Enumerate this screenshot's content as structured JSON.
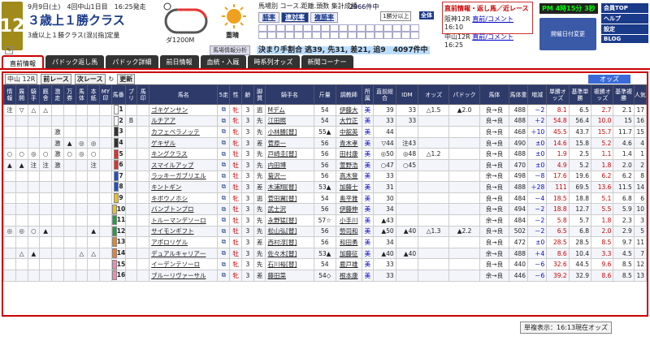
{
  "race": {
    "num": "12",
    "date": "9月9日(土)　4回中山1日目　16:25発走",
    "title": "３歳上１勝クラス",
    "cond": "3歳以上１勝クラス(混)[指]定量",
    "dist": "ダ1200M",
    "weather": "重晴"
  },
  "mid": {
    "title": "馬場別 コース.距離.頭数 集計成績",
    "tabs": [
      "勝率",
      "連対率",
      "複勝率"
    ],
    "count": "2966件中",
    "popular": "1勝分以上",
    "all": "全体",
    "analysis": "馬場情報分析",
    "kimari": "決まり手割合 逃39, 先31, 差21, 追9　4097件中"
  },
  "alerts": {
    "title": "直前情報・返し馬／近レース",
    "rows": [
      {
        "race": "阪神12R",
        "links": "直前/コメント",
        "time": "16:10"
      },
      {
        "race": "中山12R",
        "links": "直前/コメント",
        "time": "16:25"
      }
    ]
  },
  "clock": "PM 4時15分 3秒",
  "hold": "開催日付変更",
  "side": [
    "会員TOP",
    "ヘルプ",
    "設定",
    "BLOG"
  ],
  "tabs": [
    "直前情報",
    "パドック返し馬",
    "パドック詳細",
    "前日情報",
    "血統・入厩",
    "時系列オッズ",
    "新聞コーナー"
  ],
  "toolbar": {
    "race": "中山 12R",
    "prev": "前レース",
    "next": "次レース",
    "update": "更新",
    "odds": "オッズ"
  },
  "headers": [
    "情報",
    "展開",
    "騎手",
    "厩舎",
    "激走",
    "万券",
    "馬体",
    "本紙",
    "MY印",
    "馬番",
    "ブリ",
    "馬印",
    "馬名",
    "5走",
    "性",
    "齢",
    "脚質",
    "騎手名",
    "斤量",
    "調教師",
    "所属",
    "直前総合",
    "IDM",
    "オッズ",
    "パドック",
    "馬体",
    "馬体重",
    "増減",
    "単勝オッズ",
    "基準単勝",
    "複勝オッズ",
    "基準複勝",
    "人気"
  ],
  "rows": [
    {
      "mk": [
        "注",
        "▽",
        "△",
        "△",
        "",
        "",
        "",
        "",
        "",
        ""
      ],
      "n": "1",
      "bl": "",
      "horse": "ゴキゲンサン",
      "sex": "牝",
      "age": "3",
      "leg": "逃",
      "jock": "Mデム",
      "kin": "54",
      "tr": "伊藤大",
      "aff": "美",
      "tot": "39",
      "idm": "33",
      "odd": "△1.5",
      "pad": "▲2.0",
      "bt": "良→良",
      "wt": "488",
      "inc": "－2",
      "tan": "8.1",
      "ktan": "6.5",
      "fuku": "2.7",
      "kfuku": "2.1",
      "pop": "17"
    },
    {
      "mk": [
        "",
        "",
        "",
        "",
        "",
        "",
        "",
        "",
        "",
        ""
      ],
      "n": "2",
      "bl": "B",
      "horse": "ルチアア",
      "sex": "牝",
      "age": "3",
      "leg": "先",
      "jock": "江田照",
      "kin": "54",
      "tr": "大竹正",
      "aff": "美",
      "tot": "33",
      "idm": "33",
      "odd": "",
      "pad": "",
      "bt": "良→良",
      "wt": "488",
      "inc": "＋2",
      "tan": "54.8",
      "ktan": "56.4",
      "fuku": "10.0",
      "kfuku": "15",
      "pop": "16"
    },
    {
      "mk": [
        "",
        "",
        "",
        "",
        "激",
        "",
        "",
        "",
        "",
        ""
      ],
      "n": "3",
      "bl": "",
      "horse": "カフェベラノッテ",
      "sex": "牝",
      "age": "3",
      "leg": "先",
      "jock": "小林勝[替]",
      "kin": "55▲",
      "tr": "中舘英",
      "aff": "美",
      "tot": "44",
      "idm": "",
      "odd": "",
      "pad": "",
      "bt": "良→良",
      "wt": "468",
      "inc": "＋10",
      "tan": "45.5",
      "ktan": "43.7",
      "fuku": "15.7",
      "kfuku": "11.7",
      "pop": "15"
    },
    {
      "mk": [
        "",
        "",
        "",
        "",
        "激",
        "▲",
        "◎",
        "◎",
        "",
        ""
      ],
      "n": "4",
      "bl": "",
      "horse": "ゲキザル",
      "sex": "牝",
      "age": "3",
      "leg": "差",
      "jock": "菅原一",
      "kin": "56",
      "tr": "青木孝",
      "aff": "美",
      "tot": "▽44",
      "idm": "注43",
      "odd": "",
      "pad": "",
      "bt": "良→良",
      "wt": "490",
      "inc": "±0",
      "tan": "14.6",
      "ktan": "15.8",
      "fuku": "5.2",
      "kfuku": "4.6",
      "pop": "4"
    },
    {
      "mk": [
        "○",
        "○",
        "◎",
        "○",
        "激",
        "○",
        "◎",
        "○",
        "",
        ""
      ],
      "n": "5",
      "bl": "",
      "horse": "キングクラス",
      "sex": "牡",
      "age": "3",
      "leg": "先",
      "jock": "戸崎圭[替]",
      "kin": "56",
      "tr": "田村康",
      "aff": "美",
      "tot": "◎50",
      "idm": "◎48",
      "odd": "△1.2",
      "pad": "",
      "bt": "良→良",
      "wt": "488",
      "inc": "±0",
      "tan": "1.9",
      "ktan": "2.5",
      "fuku": "1.1",
      "kfuku": "1.4",
      "pop": "1"
    },
    {
      "mk": [
        "▲",
        "▲",
        "注",
        "注",
        "激",
        "",
        "",
        "注",
        "",
        ""
      ],
      "n": "6",
      "bl": "",
      "horse": "スマイルアップ",
      "sex": "牡",
      "age": "3",
      "leg": "先",
      "jock": "内田博",
      "kin": "56",
      "tr": "萱野浩",
      "aff": "美",
      "tot": "○47",
      "idm": "○45",
      "odd": "",
      "pad": "",
      "bt": "良→良",
      "wt": "470",
      "inc": "±0",
      "tan": "4.9",
      "ktan": "5.2",
      "fuku": "1.8",
      "kfuku": "2.0",
      "pop": "2"
    },
    {
      "mk": [
        "",
        "",
        "",
        "",
        "",
        "",
        "",
        "",
        "",
        ""
      ],
      "n": "7",
      "bl": "",
      "horse": "ラッキーガブリエル",
      "sex": "牡",
      "age": "3",
      "leg": "先",
      "jock": "菊沢一",
      "kin": "56",
      "tr": "高木登",
      "aff": "美",
      "tot": "33",
      "idm": "",
      "odd": "",
      "pad": "",
      "bt": "余→良",
      "wt": "498",
      "inc": "－8",
      "tan": "17.6",
      "ktan": "19.6",
      "fuku": "6.2",
      "kfuku": "6.2",
      "pop": "8"
    },
    {
      "mk": [
        "",
        "",
        "",
        "",
        "",
        "",
        "",
        "",
        "",
        ""
      ],
      "n": "8",
      "bl": "",
      "horse": "キントギン",
      "sex": "牡",
      "age": "3",
      "leg": "差",
      "jock": "木浦翔[替]",
      "kin": "53▲",
      "tr": "加藤士",
      "aff": "美",
      "tot": "31",
      "idm": "",
      "odd": "",
      "pad": "",
      "bt": "良→良",
      "wt": "488",
      "inc": "＋28",
      "tan": "111",
      "ktan": "69.5",
      "fuku": "13.6",
      "kfuku": "11.5",
      "pop": "14"
    },
    {
      "mk": [
        "",
        "",
        "",
        "",
        "",
        "",
        "",
        "",
        "",
        ""
      ],
      "n": "9",
      "bl": "",
      "horse": "キボウノホシ",
      "sex": "牝",
      "age": "3",
      "leg": "逃",
      "jock": "菅田翼[替]",
      "kin": "54",
      "tr": "奥平雅",
      "aff": "美",
      "tot": "30",
      "idm": "",
      "odd": "",
      "pad": "",
      "bt": "良→良",
      "wt": "484",
      "inc": "－4",
      "tan": "18.5",
      "ktan": "18.8",
      "fuku": "5.1",
      "kfuku": "6.8",
      "pop": "6"
    },
    {
      "mk": [
        "",
        "",
        "",
        "",
        "",
        "",
        "",
        "",
        "",
        ""
      ],
      "n": "10",
      "bl": "",
      "horse": "バンブトンプロ",
      "sex": "牡",
      "age": "3",
      "leg": "先",
      "jock": "武士沢",
      "kin": "56",
      "tr": "伊藤伸",
      "aff": "美",
      "tot": "34",
      "idm": "",
      "odd": "",
      "pad": "",
      "bt": "良→良",
      "wt": "494",
      "inc": "－2",
      "tan": "18.8",
      "ktan": "12.7",
      "fuku": "5.5",
      "kfuku": "5.9",
      "pop": "10"
    },
    {
      "mk": [
        "",
        "",
        "",
        "",
        "",
        "",
        "",
        "",
        "",
        ""
      ],
      "n": "11",
      "bl": "",
      "horse": "トルーマンデソーロ",
      "sex": "牡",
      "age": "3",
      "leg": "先",
      "jock": "永野猛[替]",
      "kin": "57☆",
      "tr": "小手川",
      "aff": "美",
      "tot": "▲43",
      "idm": "",
      "odd": "",
      "pad": "",
      "bt": "余→良",
      "wt": "484",
      "inc": "－2",
      "tan": "5.8",
      "ktan": "5.7",
      "fuku": "1.8",
      "kfuku": "2.3",
      "pop": "3"
    },
    {
      "mk": [
        "◎",
        "◎",
        "○",
        "▲",
        "",
        "",
        "",
        "▲",
        "",
        ""
      ],
      "n": "12",
      "bl": "",
      "horse": "サイモンギフト",
      "sex": "牡",
      "age": "3",
      "leg": "先",
      "jock": "松山弘[替]",
      "kin": "56",
      "tr": "勢司和",
      "aff": "美",
      "tot": "▲50",
      "idm": "▲40",
      "odd": "△1.3",
      "pad": "▲2.2",
      "bt": "良→良",
      "wt": "502",
      "inc": "－2",
      "tan": "6.5",
      "ktan": "6.8",
      "fuku": "2.0",
      "kfuku": "2.9",
      "pop": "5"
    },
    {
      "mk": [
        "",
        "",
        "",
        "",
        "",
        "",
        "",
        "",
        "",
        ""
      ],
      "n": "13",
      "bl": "",
      "horse": "アポロリゲル",
      "sex": "牡",
      "age": "3",
      "leg": "差",
      "jock": "西村淳[替]",
      "kin": "56",
      "tr": "和田勇",
      "aff": "美",
      "tot": "34",
      "idm": "",
      "odd": "",
      "pad": "",
      "bt": "良→良",
      "wt": "472",
      "inc": "±0",
      "tan": "28.5",
      "ktan": "28.5",
      "fuku": "8.5",
      "kfuku": "9.7",
      "pop": "11"
    },
    {
      "mk": [
        "",
        "△",
        "▲",
        "",
        "",
        "",
        "△",
        "△",
        "",
        ""
      ],
      "n": "14",
      "bl": "",
      "horse": "デュアルキャリア一",
      "sex": "牡",
      "age": "3",
      "leg": "先",
      "jock": "佐々木[替]",
      "kin": "53▲",
      "tr": "加藤征",
      "aff": "美",
      "tot": "▲40",
      "idm": "▲40",
      "odd": "",
      "pad": "",
      "bt": "余→良",
      "wt": "488",
      "inc": "＋4",
      "tan": "8.6",
      "ktan": "10.4",
      "fuku": "3.3",
      "kfuku": "4.5",
      "pop": "7"
    },
    {
      "mk": [
        "",
        "",
        "",
        "",
        "",
        "",
        "",
        "",
        "",
        ""
      ],
      "n": "15",
      "bl": "",
      "horse": "イーデンテソーロ",
      "sex": "牝",
      "age": "3",
      "leg": "先",
      "jock": "石川裕[替]",
      "kin": "54",
      "tr": "鹿戸雄",
      "aff": "美",
      "tot": "33",
      "idm": "",
      "odd": "",
      "pad": "",
      "bt": "良→良",
      "wt": "440",
      "inc": "－6",
      "tan": "32.6",
      "ktan": "44.5",
      "fuku": "9.6",
      "kfuku": "8.5",
      "pop": "12"
    },
    {
      "mk": [
        "",
        "",
        "",
        "",
        "",
        "",
        "",
        "",
        "",
        ""
      ],
      "n": "16",
      "bl": "",
      "horse": "ブルーリヴァーサル",
      "sex": "牝",
      "age": "3",
      "leg": "差",
      "jock": "藤田菜",
      "kin": "54◇",
      "tr": "根本康",
      "aff": "美",
      "tot": "33",
      "idm": "",
      "odd": "",
      "pad": "",
      "bt": "余→良",
      "wt": "446",
      "inc": "－6",
      "tan": "39.2",
      "ktan": "32.9",
      "fuku": "8.6",
      "kfuku": "8.5",
      "pop": "13"
    }
  ],
  "gate_colors": [
    "#ffffff",
    "#ffffff",
    "#333333",
    "#333333",
    "#e03030",
    "#e03030",
    "#2050c8",
    "#2050c8",
    "#e8c020",
    "#e8c020",
    "#20a040",
    "#20a040",
    "#f08020",
    "#f08020",
    "#f08ab0",
    "#f08ab0"
  ],
  "footer": "単複表示：16:13現在オッズ"
}
